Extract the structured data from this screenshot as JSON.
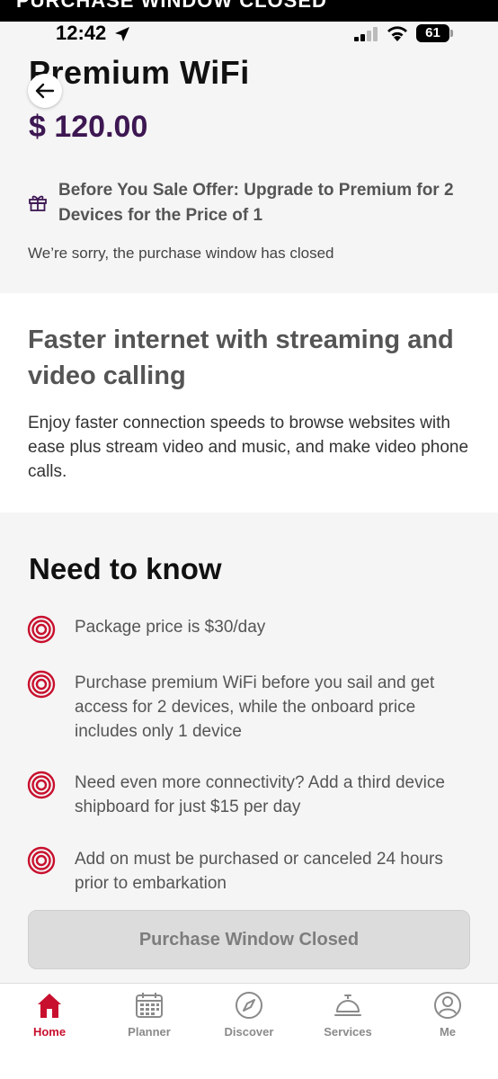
{
  "banner": {
    "text": "PURCHASE WINDOW CLOSED"
  },
  "status_bar": {
    "time": "12:42",
    "battery": "61"
  },
  "product": {
    "title": "Premium WiFi",
    "price": "$ 120.00",
    "offer": "Before You Sale Offer: Upgrade to Premium for 2 Devices for the Price of 1",
    "closed_message": "We’re sorry, the purchase window has closed"
  },
  "description": {
    "heading": "Faster internet with streaming and video calling",
    "body": "Enjoy faster connection speeds to browse websites with ease plus stream video and music, and make video phone calls."
  },
  "need_to_know": {
    "heading": "Need to know",
    "items": [
      "Package price is $30/day",
      "Purchase premium WiFi before you sail and get access for 2 devices, while the onboard price includes only 1 device",
      "Need even more connectivity? Add a third device shipboard for just $15 per day",
      "Add on must be purchased or canceled 24 hours prior to embarkation"
    ]
  },
  "purchase_button": {
    "label": "Purchase Window Closed"
  },
  "tab_bar": {
    "tabs": [
      {
        "label": "Home",
        "icon": "home-icon",
        "active": true
      },
      {
        "label": "Planner",
        "icon": "calendar-icon",
        "active": false
      },
      {
        "label": "Discover",
        "icon": "compass-icon",
        "active": false
      },
      {
        "label": "Services",
        "icon": "service-bell-icon",
        "active": false
      },
      {
        "label": "Me",
        "icon": "profile-icon",
        "active": false
      }
    ]
  },
  "colors": {
    "brand_red": "#c8102e",
    "price_purple": "#3d1752",
    "disabled_button": "#dcdcdc"
  }
}
